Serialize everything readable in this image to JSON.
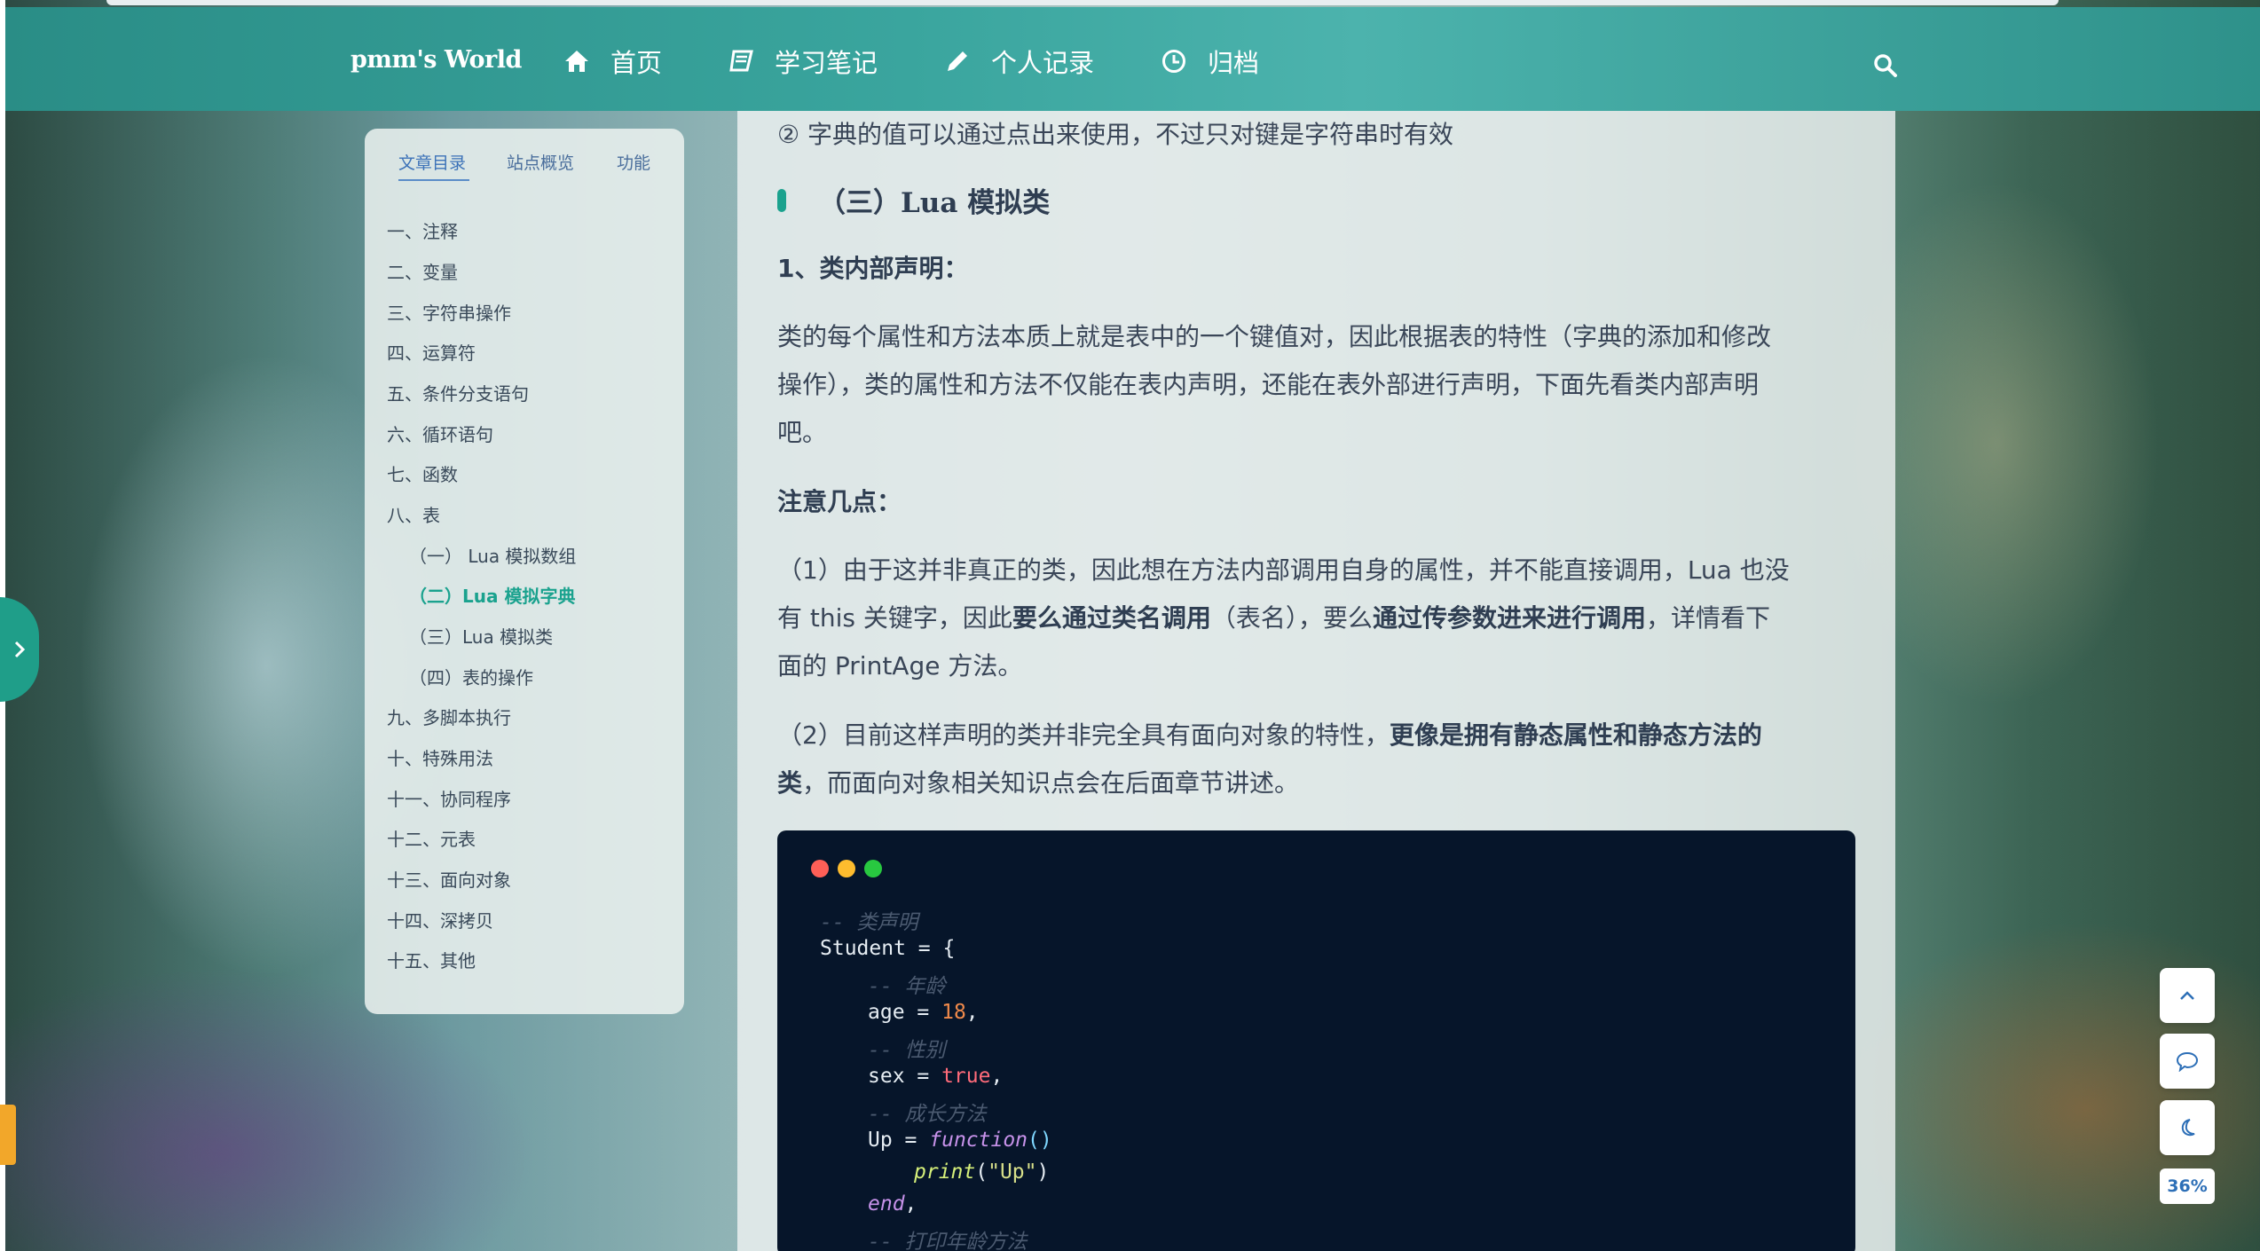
{
  "header": {
    "brand": "pmm's World",
    "nav": [
      {
        "label": "首页",
        "icon": "home-icon"
      },
      {
        "label": "学习笔记",
        "icon": "book-icon"
      },
      {
        "label": "个人记录",
        "icon": "pencil-icon"
      },
      {
        "label": "归档",
        "icon": "clock-icon"
      }
    ],
    "search_icon": "search-icon"
  },
  "toc": {
    "tabs": [
      "文章目录",
      "站点概览",
      "功能"
    ],
    "active_tab": "文章目录",
    "items": [
      "一、注释",
      "二、变量",
      "三、字符串操作",
      "四、运算符",
      "五、条件分支语句",
      "六、循环语句",
      "七、函数",
      "八、表",
      "（一） Lua 模拟数组",
      "（二）Lua 模拟字典",
      "（三）Lua 模拟类",
      "（四）表的操作",
      "九、多脚本执行",
      "十、特殊用法",
      "十一、协同程序",
      "十二、元表",
      "十三、面向对象",
      "十四、深拷贝",
      "十五、其他"
    ],
    "active_item": "（二）Lua 模拟字典"
  },
  "article": {
    "line_top": "② 字典的值可以通过点出来使用，不过只对键是字符串时有效",
    "heading": "（三）Lua 模拟类",
    "subheading": "1、类内部声明：",
    "para1_l1": "类的每个属性和方法本质上就是表中的一个键值对，因此根据表的特性（字典的添加和修改",
    "para1_l2": "操作），类的属性和方法不仅能在表内声明，还能在表外部进行声明，下面先看类内部声明",
    "para1_l3": "吧。",
    "notes_title": "注意几点：",
    "note1_l1": "（1）由于这并非真正的类，因此想在方法内部调用自身的属性，并不能直接调用，Lua 也没",
    "note1_l2_a": "有 this 关键字，因此",
    "note1_l2_b": "要么通过类名调用",
    "note1_l2_c": "（表名），要么",
    "note1_l2_d": "通过传参数进来进行调用",
    "note1_l2_e": "，详情看下",
    "note1_l3": "面的 PrintAge 方法。",
    "note2_l1_a": "（2）目前这样声明的类并非完全具有面向对象的特性，",
    "note2_l1_b": "更像是拥有静态属性和静态方法的",
    "note2_l2_a": "类",
    "note2_l2_b": "，而面向对象相关知识点会在后面章节讲述。"
  },
  "code": {
    "dots": [
      "#ff5f57",
      "#febc2e",
      "#28c840"
    ],
    "lines": {
      "l1": "-- 类声明",
      "l2": "Student = {",
      "l3": "-- 年龄",
      "l4_a": "age = ",
      "l4_b": "18",
      "l4_c": ",",
      "l5": "-- 性别",
      "l6_a": "sex = ",
      "l6_b": "true",
      "l6_c": ",",
      "l7": "-- 成长方法",
      "l8_a": "Up = ",
      "l8_b": "function",
      "l8_c": "()",
      "l9_a": "print",
      "l9_b": "(",
      "l9_c": "\"Up\"",
      "l9_d": ")",
      "l10_a": "end",
      "l10_b": ",",
      "l11": "-- 打印年龄方法"
    }
  },
  "floating": {
    "buttons": [
      "chevron-up-icon",
      "comment-icon",
      "moon-icon"
    ],
    "progress_label": "36%",
    "progress": 0.36
  },
  "colors": {
    "accent": "#1aa28e",
    "header": "#3aa59e",
    "code_bg": "#06152a"
  }
}
